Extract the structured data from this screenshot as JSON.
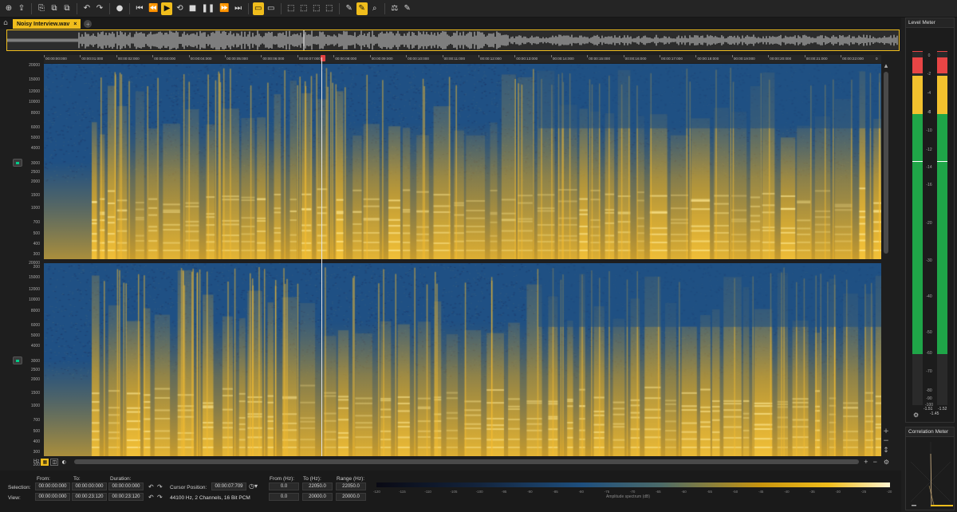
{
  "toolbar": {
    "buttons": [
      "⊕",
      "⇪",
      "⎘",
      "⧉",
      "⧉",
      "↶",
      "↷",
      "●",
      "⏮",
      "⏪",
      "▶",
      "⟲",
      "■",
      "❚❚",
      "⏩",
      "⏭",
      "▭",
      "▭",
      "⬚",
      "⬚",
      "⬚",
      "⬚",
      "✎",
      "✎",
      "⌕",
      "⚖",
      "✎"
    ],
    "active_indices": [
      10,
      16,
      23
    ]
  },
  "tabs": {
    "home_icon": "home-icon",
    "file_tab_label": "Noisy Interview.wav",
    "close_label": "×",
    "add_label": "+"
  },
  "ruler": {
    "ticks": [
      "00:00:00:000",
      "00:00:01:000",
      "00:00:02:000",
      "00:00:03:000",
      "00:00:04:000",
      "00:00:05:000",
      "00:00:06:000",
      "00:00:07:000",
      "00:00:08:000",
      "00:00:09:000",
      "00:00:10:000",
      "00:00:11:000",
      "00:00:12:000",
      "00:00:13:000",
      "00:00:14:000",
      "00:00:15:000",
      "00:00:16:000",
      "00:00:17:000",
      "00:00:18:000",
      "00:00:19:000",
      "00:00:20:000",
      "00:00:21:000",
      "00:00:22:000"
    ],
    "end_label": "0"
  },
  "frequency_axis": {
    "labels": [
      "20000",
      "15000",
      "12000",
      "10000",
      "8000",
      "6000",
      "5000",
      "4000",
      "3000",
      "2500",
      "2000",
      "1500",
      "1000",
      "700",
      "500",
      "400",
      "300",
      "200"
    ],
    "unit": "Hz"
  },
  "status": {
    "from_label": "From:",
    "to_label": "To:",
    "duration_label": "Duration:",
    "selection_label": "Selection:",
    "view_label": "View:",
    "selection_from": "00:00:00:000",
    "selection_to": "00:00:00:000",
    "selection_duration": "00:00:00:000",
    "view_from": "00:00:00:000",
    "view_to": "00:00:23:120",
    "view_duration": "00:00:23:120",
    "cursor_position_label": "Cursor Position:",
    "cursor_position": "00:00:07:709",
    "format_info": "44100 Hz, 2 Channels, 16 Bit PCM",
    "from_hz_label": "From (Hz):",
    "to_hz_label": "To (Hz):",
    "range_hz_label": "Range (Hz):",
    "sel_from_hz": "0.0",
    "sel_to_hz": "22050.0",
    "sel_range_hz": "22050.0",
    "view_from_hz": "0.0",
    "view_to_hz": "20000.0",
    "view_range_hz": "20000.0"
  },
  "colorbar": {
    "ticks": [
      "-120",
      "-115",
      "-110",
      "-105",
      "-100",
      "-95",
      "-90",
      "-85",
      "-80",
      "-75",
      "-70",
      "-65",
      "-60",
      "-55",
      "-50",
      "-45",
      "-40",
      "-35",
      "-30",
      "-25",
      "-20"
    ],
    "title": "Amplitude spectrum (dB)"
  },
  "level_meter": {
    "title": "Level Meter",
    "scale": [
      "0",
      "-2",
      "-4",
      "-6",
      "-8",
      "-10",
      "-12",
      "-14",
      "-16",
      "-20",
      "-30",
      "-40",
      "-50",
      "-60",
      "-70",
      "-80",
      "-90",
      "-100"
    ],
    "peak_left": "-1.51",
    "peak_right": "-1.52",
    "rms": "-1.45",
    "colors": {
      "red": "#e84545",
      "yellow": "#f2c12e",
      "green": "#1fa548"
    }
  },
  "correlation_meter": {
    "title": "Correlation Meter"
  },
  "hscroll": {
    "hz_label": "Hz",
    "zoom_in": "+",
    "zoom_out": "−",
    "settings_icon": "⚙"
  }
}
